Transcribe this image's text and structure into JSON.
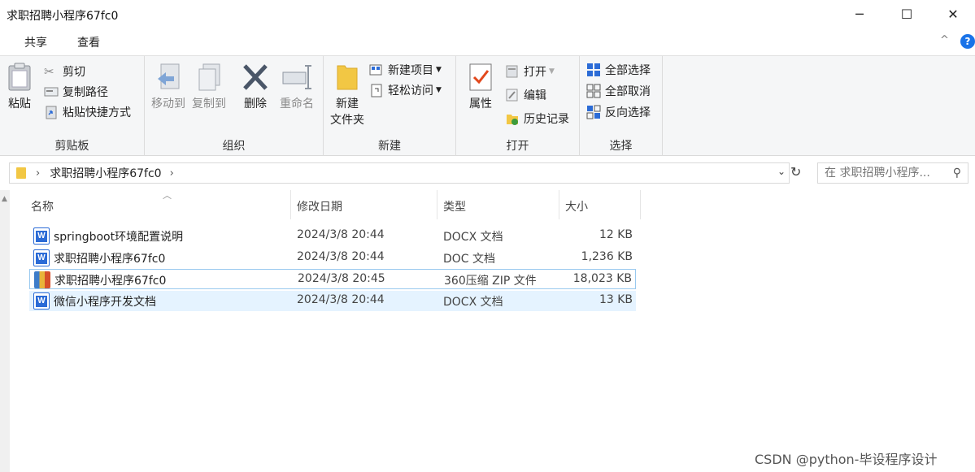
{
  "window": {
    "title": "求职招聘小程序67fc0",
    "min_label": "─",
    "max_label": "☐",
    "close_label": "✕"
  },
  "tabs": {
    "share": "共享",
    "view": "查看",
    "collapse": "^",
    "help": "?"
  },
  "ribbon": {
    "clipboard": {
      "label": "剪贴板",
      "paste": "粘贴",
      "cut": "剪切",
      "copy_path": "复制路径",
      "paste_shortcut": "粘贴快捷方式"
    },
    "organize": {
      "label": "组织",
      "move_to": "移动到",
      "copy_to": "复制到",
      "delete": "删除",
      "rename": "重命名"
    },
    "new": {
      "label": "新建",
      "new_folder_line1": "新建",
      "new_folder_line2": "文件夹",
      "new_item": "新建项目",
      "easy_access": "轻松访问"
    },
    "open": {
      "label": "打开",
      "properties": "属性",
      "open": "打开",
      "edit": "编辑",
      "history": "历史记录"
    },
    "select": {
      "label": "选择",
      "select_all": "全部选择",
      "select_none": "全部取消",
      "invert": "反向选择"
    }
  },
  "address": {
    "crumb": "求职招聘小程序67fc0",
    "search_placeholder": "在 求职招聘小程序..."
  },
  "columns": {
    "name": "名称",
    "date": "修改日期",
    "type": "类型",
    "size": "大小"
  },
  "files": [
    {
      "name": "springboot环境配置说明",
      "date": "2024/3/8 20:44",
      "type": "DOCX 文档",
      "size": "12 KB",
      "icon": "word-doc-icon"
    },
    {
      "name": "求职招聘小程序67fc0",
      "date": "2024/3/8 20:44",
      "type": "DOC 文档",
      "size": "1,236 KB",
      "icon": "word-doc-icon"
    },
    {
      "name": "求职招聘小程序67fc0",
      "date": "2024/3/8 20:45",
      "type": "360压缩 ZIP 文件",
      "size": "18,023 KB",
      "icon": "zip-archive-icon"
    },
    {
      "name": "微信小程序开发文档",
      "date": "2024/3/8 20:44",
      "type": "DOCX 文档",
      "size": "13 KB",
      "icon": "word-doc-icon"
    }
  ],
  "watermark": "CSDN @python-毕设程序设计"
}
